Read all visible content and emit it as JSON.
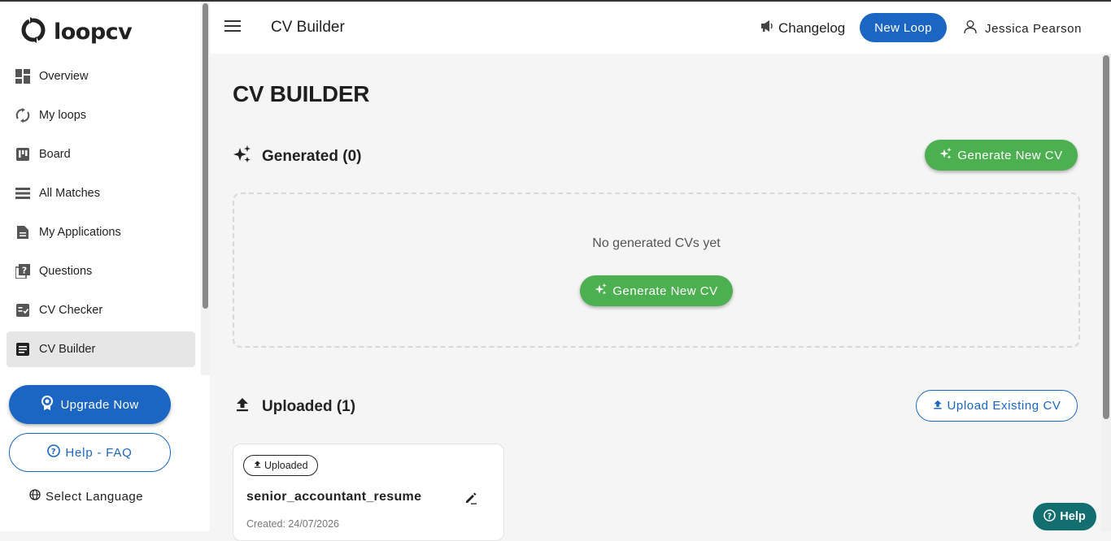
{
  "brand": {
    "name": "loopcv"
  },
  "sidebar": {
    "items": [
      {
        "label": "Overview",
        "icon": "dashboard-icon"
      },
      {
        "label": "My loops",
        "icon": "sync-icon"
      },
      {
        "label": "Board",
        "icon": "board-icon"
      },
      {
        "label": "All Matches",
        "icon": "list-icon"
      },
      {
        "label": "My Applications",
        "icon": "document-icon"
      },
      {
        "label": "Questions",
        "icon": "question-icon"
      },
      {
        "label": "CV Checker",
        "icon": "checklist-icon"
      },
      {
        "label": "CV Builder",
        "icon": "article-icon",
        "active": true
      }
    ],
    "upgrade_label": "Upgrade Now",
    "faq_label": "Help - FAQ",
    "language_label": "Select Language"
  },
  "header": {
    "title": "CV Builder",
    "changelog_label": "Changelog",
    "new_loop_label": "New Loop",
    "user_name": "Jessica Pearson"
  },
  "main": {
    "page_title": "CV BUILDER",
    "generated": {
      "heading": "Generated (0)",
      "generate_label": "Generate New CV",
      "empty_text": "No generated CVs yet"
    },
    "uploaded": {
      "heading": "Uploaded (1)",
      "upload_label": "Upload Existing CV",
      "cards": [
        {
          "badge": "Uploaded",
          "title": "senior_accountant_resume",
          "created": "Created: 24/07/2026"
        }
      ]
    }
  },
  "help_fab_label": "Help",
  "colors": {
    "primary": "#1a66c2",
    "success": "#4caf50",
    "help": "#126e6f"
  }
}
